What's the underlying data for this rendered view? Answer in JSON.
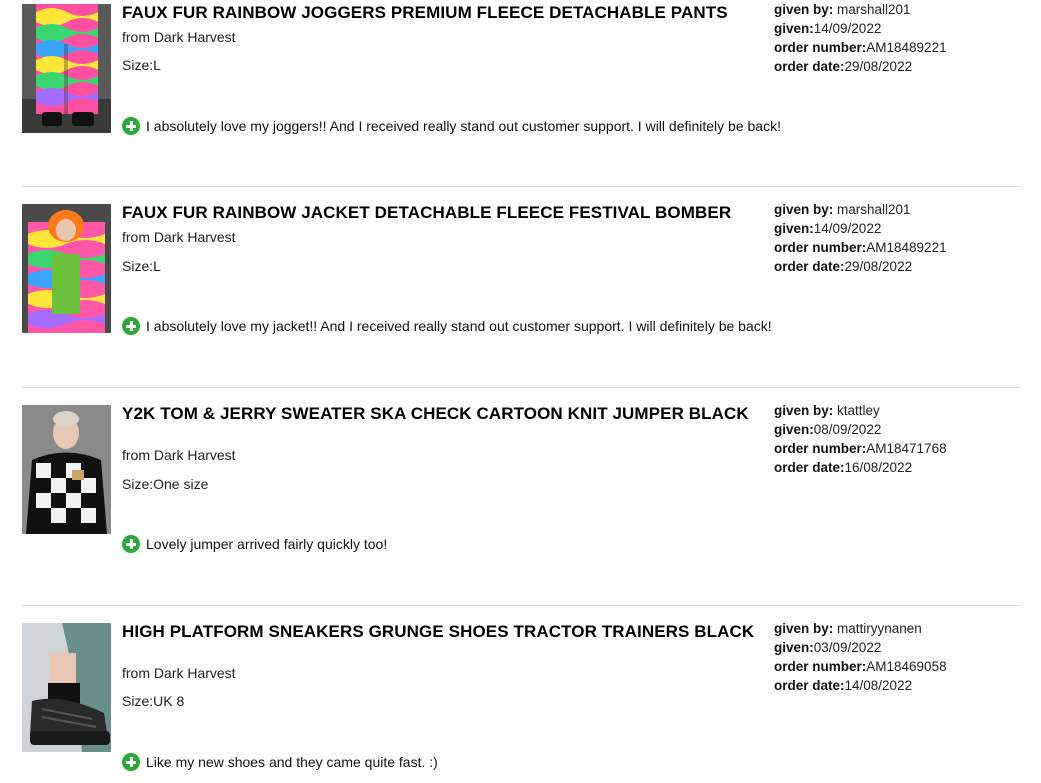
{
  "reviews": [
    {
      "title": "FAUX FUR RAINBOW JOGGERS PREMIUM FLEECE DETACHABLE PANTS",
      "from": "from Dark Harvest",
      "size": "Size:L",
      "comment": "I absolutely love my joggers!! And I received really stand out customer support. I will definitely be back!",
      "given_by_label": "given by:",
      "given_by": " marshall201",
      "given_label": "given:",
      "given": "14/09/2022",
      "order_number_label": "order number:",
      "order_number": "AM18489221",
      "order_date_label": "order date:",
      "order_date": "29/08/2022",
      "thumb_icon": "product-photo-joggers"
    },
    {
      "title": "FAUX FUR RAINBOW JACKET DETACHABLE FLEECE FESTIVAL BOMBER",
      "from": "from Dark Harvest",
      "size": "Size:L",
      "comment": "I absolutely love my jacket!! And I received really stand out customer support. I will definitely be back!",
      "given_by_label": "given by:",
      "given_by": " marshall201",
      "given_label": "given:",
      "given": "14/09/2022",
      "order_number_label": "order number:",
      "order_number": "AM18489221",
      "order_date_label": "order date:",
      "order_date": "29/08/2022",
      "thumb_icon": "product-photo-jacket"
    },
    {
      "title": "Y2K TOM & JERRY SWEATER SKA CHECK CARTOON KNIT JUMPER BLACK",
      "from": "from Dark Harvest",
      "size": "Size:One size",
      "comment": "Lovely jumper arrived fairly quickly too!",
      "given_by_label": "given by:",
      "given_by": " ktattley",
      "given_label": "given:",
      "given": "08/09/2022",
      "order_number_label": "order number:",
      "order_number": "AM18471768",
      "order_date_label": "order date:",
      "order_date": "16/08/2022",
      "thumb_icon": "product-photo-sweater"
    },
    {
      "title": "HIGH PLATFORM SNEAKERS GRUNGE SHOES TRACTOR TRAINERS BLACK",
      "from": "from Dark Harvest",
      "size": "Size:UK 8",
      "comment": "Like my new shoes and they came quite fast. :)",
      "given_by_label": "given by:",
      "given_by": " mattiryynanen",
      "given_label": "given:",
      "given": "03/09/2022",
      "order_number_label": "order number:",
      "order_number": "AM18469058",
      "order_date_label": "order date:",
      "order_date": "14/08/2022",
      "thumb_icon": "product-photo-sneakers"
    }
  ],
  "colors": {
    "positive_icon": "#2aa83a",
    "divider": "#d8d8d8"
  }
}
